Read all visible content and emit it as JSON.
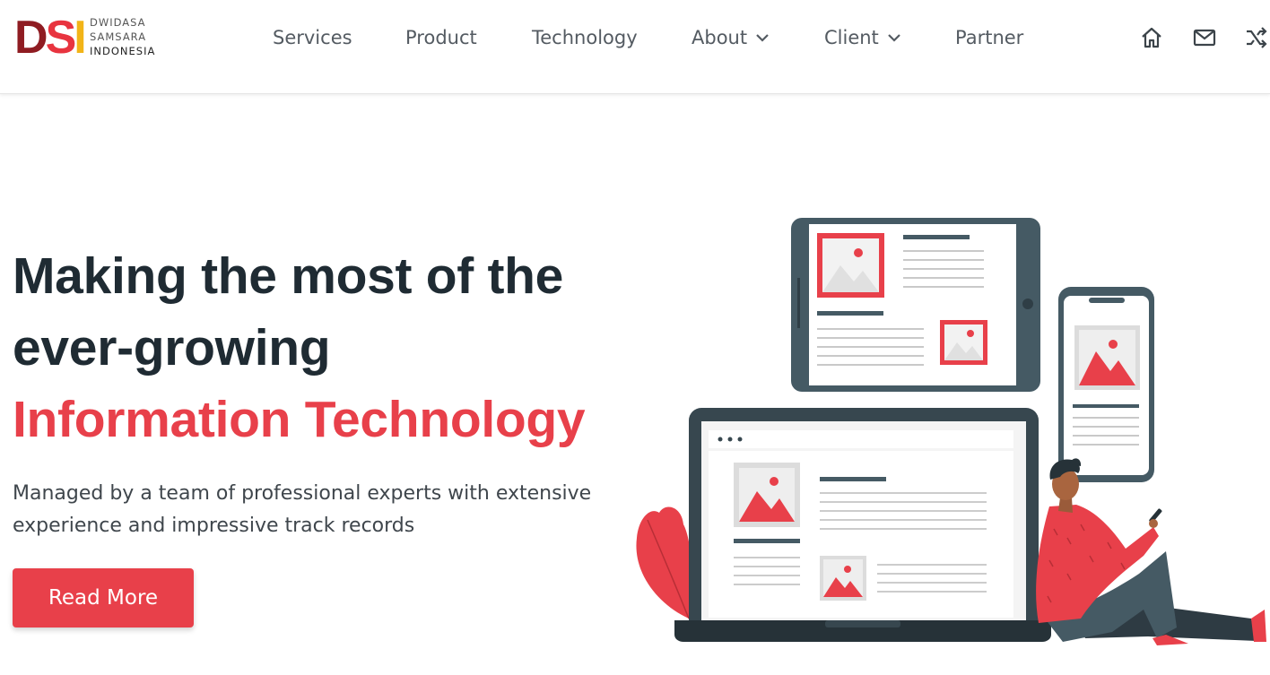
{
  "brand": {
    "mark": [
      "D",
      "S",
      "I"
    ],
    "lines": [
      "DWIDASA",
      "SAMSARA",
      "INDONESIA"
    ]
  },
  "nav": [
    {
      "label": "Services",
      "dropdown": false
    },
    {
      "label": "Product",
      "dropdown": false
    },
    {
      "label": "Technology",
      "dropdown": false
    },
    {
      "label": "About",
      "dropdown": true
    },
    {
      "label": "Client",
      "dropdown": true
    },
    {
      "label": "Partner",
      "dropdown": false
    }
  ],
  "top_icons": [
    "home-icon",
    "mail-icon",
    "shuffle-icon"
  ],
  "hero": {
    "title_line1": "Making the most of the",
    "title_line2": "ever-growing",
    "title_accent": "Information Technology",
    "subtitle": "Managed by a team of professional experts with extensive experience and impressive track records",
    "cta_label": "Read More"
  },
  "colors": {
    "accent": "#e8404a",
    "brand_dark_red": "#8f1c22",
    "brand_yellow": "#f2b418",
    "heading": "#1f2b33",
    "nav_text": "#545b62",
    "device_frame": "#455a64"
  }
}
